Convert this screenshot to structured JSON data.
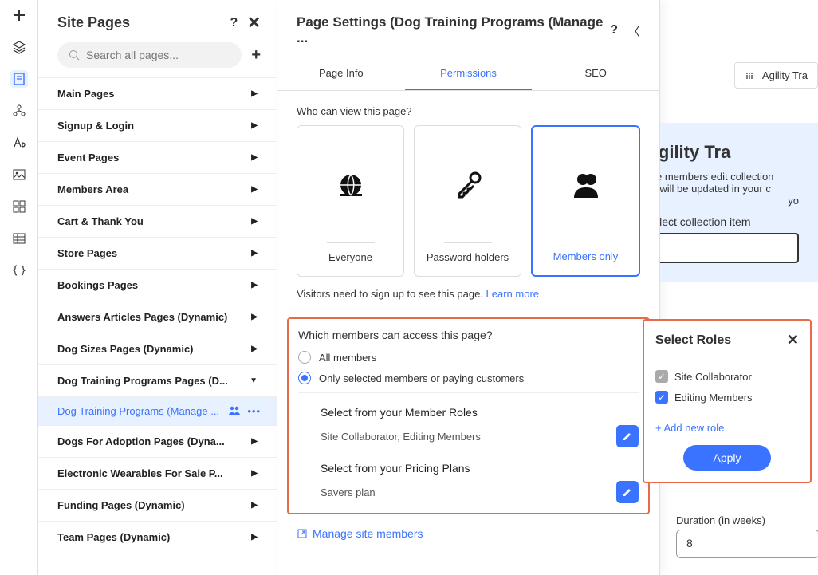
{
  "left_rail": {
    "icons": [
      "plus",
      "layers",
      "page",
      "sitemap",
      "font",
      "image",
      "grid",
      "table",
      "braces"
    ]
  },
  "site_pages": {
    "title": "Site Pages",
    "search_placeholder": "Search all pages...",
    "categories": [
      {
        "label": "Main Pages",
        "expanded": false
      },
      {
        "label": "Signup & Login",
        "expanded": false
      },
      {
        "label": "Event Pages",
        "expanded": false
      },
      {
        "label": "Members Area",
        "expanded": false
      },
      {
        "label": "Cart & Thank You",
        "expanded": false
      },
      {
        "label": "Store Pages",
        "expanded": false
      },
      {
        "label": "Bookings Pages",
        "expanded": false
      },
      {
        "label": "Answers Articles Pages (Dynamic)",
        "expanded": false
      },
      {
        "label": "Dog Sizes Pages (Dynamic)",
        "expanded": false
      },
      {
        "label": "Dog Training Programs Pages (D...",
        "expanded": true,
        "active_child": "Dog Training Programs (Manage ..."
      },
      {
        "label": "Dogs For Adoption Pages (Dyna...",
        "expanded": false
      },
      {
        "label": "Electronic Wearables For Sale P...",
        "expanded": false
      },
      {
        "label": "Funding Pages (Dynamic)",
        "expanded": false
      },
      {
        "label": "Team Pages (Dynamic)",
        "expanded": false
      }
    ]
  },
  "page_settings": {
    "title": "Page Settings (Dog Training Programs (Manage ...",
    "tabs": {
      "info": "Page Info",
      "permissions": "Permissions",
      "seo": "SEO",
      "active": "permissions"
    },
    "who_can_view": "Who can view this page?",
    "perm_options": [
      {
        "key": "everyone",
        "label": "Everyone"
      },
      {
        "key": "password",
        "label": "Password holders"
      },
      {
        "key": "members",
        "label": "Members only",
        "selected": true
      }
    ],
    "note_text": "Visitors need to sign up to see this page. ",
    "learn_more": "Learn more",
    "which_members": "Which members can access this page?",
    "radio_all": "All members",
    "radio_selected": "Only selected members or paying customers",
    "radio_choice": "selected",
    "member_roles_title": "Select from your Member Roles",
    "member_roles_value": "Site Collaborator, Editing Members",
    "pricing_plans_title": "Select from your Pricing Plans",
    "pricing_plans_value": "Savers plan",
    "manage_members": "Manage site members"
  },
  "right": {
    "pill_label": "Agility Tra",
    "hero_title": "Agility Tra",
    "hero_text1": "site members edit collection",
    "hero_text2": "es will be updated in your c",
    "hero_text3": "yo",
    "collection_label": "Select collection item",
    "duration_label": "Duration (in weeks)",
    "duration_value": "8"
  },
  "select_roles": {
    "title": "Select Roles",
    "roles": [
      {
        "label": "Site Collaborator",
        "locked": true
      },
      {
        "label": "Editing Members",
        "checked": true
      }
    ],
    "add_new": "+ Add new role",
    "apply": "Apply"
  }
}
